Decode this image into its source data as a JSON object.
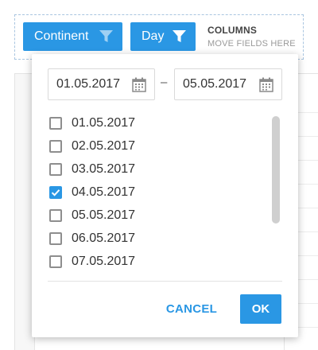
{
  "header": {
    "chips": [
      {
        "label": "Continent",
        "icon": "filter-icon"
      },
      {
        "label": "Day",
        "icon": "filter-icon"
      }
    ],
    "columns_title": "COLUMNS",
    "columns_hint": "MOVE FIELDS HERE"
  },
  "filter_popup": {
    "date_from": "01.05.2017",
    "date_to": "05.05.2017",
    "range_separator": "–",
    "items": [
      {
        "label": "01.05.2017",
        "checked": false
      },
      {
        "label": "02.05.2017",
        "checked": false
      },
      {
        "label": "03.05.2017",
        "checked": false
      },
      {
        "label": "04.05.2017",
        "checked": true
      },
      {
        "label": "05.05.2017",
        "checked": false
      },
      {
        "label": "06.05.2017",
        "checked": false
      },
      {
        "label": "07.05.2017",
        "checked": false
      }
    ],
    "cancel_label": "CANCEL",
    "ok_label": "OK"
  },
  "colors": {
    "accent": "#2a97e4",
    "checkbox_border": "#8e8e8e"
  }
}
